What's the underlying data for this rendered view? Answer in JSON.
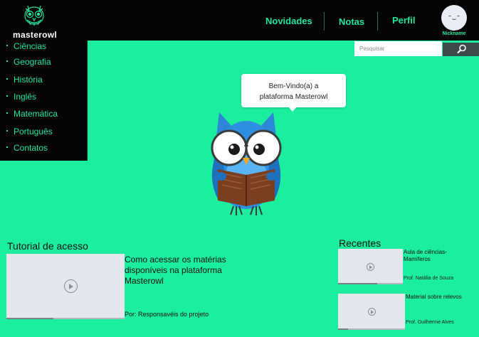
{
  "header": {
    "brand": "masterowl",
    "nav": [
      {
        "label": "Novidades"
      },
      {
        "label": "Notas"
      },
      {
        "label": "Perfil"
      }
    ],
    "nickname": "Nickname"
  },
  "sidebar": {
    "items": [
      {
        "label": "Ciências"
      },
      {
        "label": "Geografia"
      },
      {
        "label": "História"
      },
      {
        "label": "Inglês"
      },
      {
        "label": "Matemática"
      },
      {
        "label": "Português"
      },
      {
        "label": "Contatos"
      }
    ]
  },
  "search": {
    "placeholder": "Pesquisar",
    "icon": "search-icon"
  },
  "welcome": {
    "line1": "Bem-Vindo(a) a",
    "line2": "plataforma Masterowl"
  },
  "tutorial": {
    "title": "Tutorial de acesso",
    "description": "Como acessar os matérias disponíveis na plataforma Masterowl",
    "author": "Por: Responsavéis do projeto",
    "progress": 0.4
  },
  "recent": {
    "title": "Recentes",
    "items": [
      {
        "title": "Aula de ciências-Mamíferos",
        "author": "Prof. Natália de Souza",
        "progress": 0.6
      },
      {
        "title": "Material sobre relevos",
        "author": "Prof. Guilherme Alves",
        "progress": 0.15
      }
    ]
  },
  "colors": {
    "background": "#1ceea0",
    "header": "#050505",
    "accent": "#1ee6a0"
  }
}
